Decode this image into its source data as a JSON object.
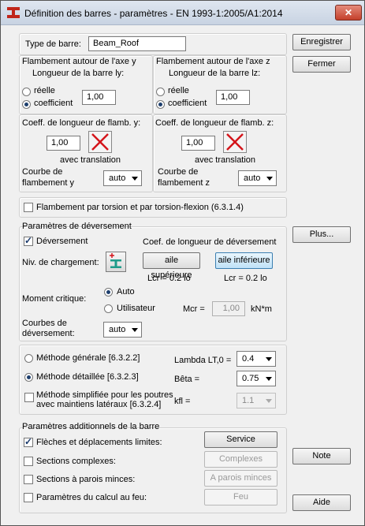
{
  "window": {
    "title": "Définition des barres - paramètres - EN 1993-1:2005/A1:2014",
    "close": "✕"
  },
  "type_barre": {
    "label": "Type de barre:",
    "value": "Beam_Roof"
  },
  "flamb_y": {
    "title": "Flambement autour de l'axe y",
    "subtitle": "Longueur de la barre ly:",
    "opt_reelle": "réelle",
    "opt_coeff": "coefficient",
    "value": "1,00",
    "coeff_label": "Coeff. de longueur de flamb. y:",
    "coeff_value": "1,00",
    "translation": "avec translation",
    "courbe_label1": "Courbe de",
    "courbe_label2": "flambement  y",
    "courbe_value": "auto"
  },
  "flamb_z": {
    "title": "Flambement autour de l'axe z",
    "subtitle": "Longueur de la barre lz:",
    "opt_reelle": "réelle",
    "opt_coeff": "coefficient",
    "value": "1,00",
    "coeff_label": "Coeff. de longueur de flamb. z:",
    "coeff_value": "1,00",
    "translation": "avec translation",
    "courbe_label1": "Courbe de",
    "courbe_label2": "flambement  z",
    "courbe_value": "auto"
  },
  "torsion": {
    "label": "Flambement par torsion et par torsion-flexion (6.3.1.4)"
  },
  "deversement": {
    "title": "Paramètres de déversement",
    "check_label": "Déversement",
    "coef_label": "Coef. de longueur de déversement",
    "niv_label": "Niv. de chargement:",
    "aile_sup": "aile supérieure",
    "aile_inf": "aile inférieure",
    "lcr1": "Lcr = 0.2 lo",
    "lcr2": "Lcr = 0.2 lo",
    "moment_label": "Moment critique:",
    "opt_auto": "Auto",
    "opt_user": "Utilisateur",
    "mcr_label": "Mcr =",
    "mcr_value": "1,00",
    "mcr_unit": "kN*m",
    "courbes_label1": "Courbes de",
    "courbes_label2": "déversement:",
    "courbes_value": "auto"
  },
  "methodes": {
    "generale": "Méthode générale  [6.3.2.2]",
    "detaillee": "Méthode détaillée  [6.3.2.3]",
    "simplifiee1": "Méthode simplifiée pour les poutres",
    "simplifiee2": "avec maintiens latéraux [6.3.2.4]",
    "lambda_label": "Lambda LT,0 =",
    "lambda_value": "0.4",
    "beta_label": "Bêta =",
    "beta_value": "0.75",
    "kfl_label": "kfl =",
    "kfl_value": "1.1"
  },
  "additionnels": {
    "title": "Paramètres additionnels de la barre",
    "fleches": "Flèches et déplacements limites:",
    "complexes": "Sections complexes:",
    "parois": "Sections à parois minces:",
    "feu": "Paramètres du calcul au feu:",
    "btn_service": "Service",
    "btn_complexes": "Complexes",
    "btn_parois": "A parois minces",
    "btn_feu": "Feu"
  },
  "buttons": {
    "enregistrer": "Enregistrer",
    "fermer": "Fermer",
    "plus": "Plus...",
    "note": "Note",
    "aide": "Aide"
  }
}
